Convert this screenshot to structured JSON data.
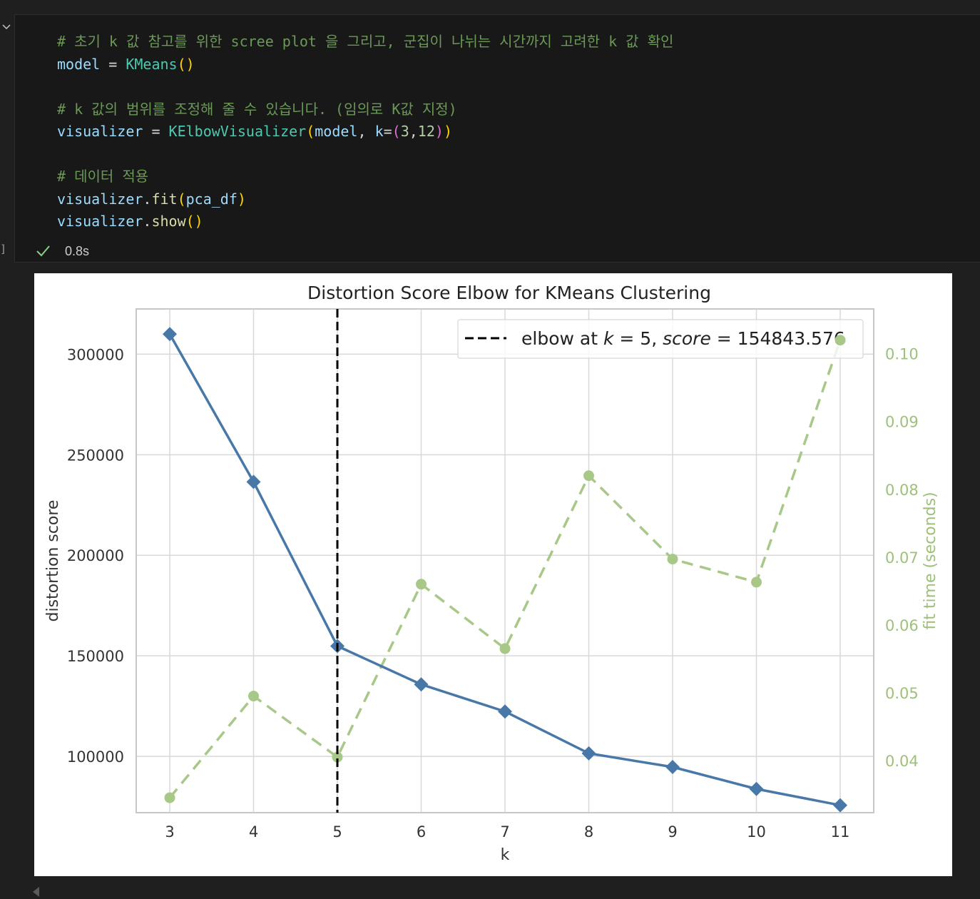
{
  "editor": {
    "gutter_bracket": "]",
    "status_time": "0.8s",
    "code_lines": [
      [
        {
          "t": "# 초기 k 값 참고를 위한 scree plot 을 그리고, 군집이 나뉘는 시간까지 고려한 k 값 확인",
          "c": "cm"
        }
      ],
      [
        {
          "t": "model",
          "c": "var"
        },
        {
          "t": " = ",
          "c": "op"
        },
        {
          "t": "KMeans",
          "c": "cls"
        },
        {
          "t": "()",
          "c": "pa"
        }
      ],
      [],
      [
        {
          "t": "# k 값의 범위를 조정해 줄 수 있습니다. (임의로 K값 지정)",
          "c": "cm"
        }
      ],
      [
        {
          "t": "visualizer",
          "c": "var"
        },
        {
          "t": " = ",
          "c": "op"
        },
        {
          "t": "KElbowVisualizer",
          "c": "cls"
        },
        {
          "t": "(",
          "c": "pa"
        },
        {
          "t": "model",
          "c": "var"
        },
        {
          "t": ", ",
          "c": "op"
        },
        {
          "t": "k",
          "c": "var"
        },
        {
          "t": "=",
          "c": "op"
        },
        {
          "t": "(",
          "c": "pb"
        },
        {
          "t": "3",
          "c": "num"
        },
        {
          "t": ",",
          "c": "op"
        },
        {
          "t": "12",
          "c": "num"
        },
        {
          "t": ")",
          "c": "pb"
        },
        {
          "t": ")",
          "c": "pa"
        }
      ],
      [],
      [
        {
          "t": "# 데이터 적용",
          "c": "cm"
        }
      ],
      [
        {
          "t": "visualizer",
          "c": "var"
        },
        {
          "t": ".",
          "c": "op"
        },
        {
          "t": "fit",
          "c": "fn"
        },
        {
          "t": "(",
          "c": "pa"
        },
        {
          "t": "pca_df",
          "c": "var"
        },
        {
          "t": ")",
          "c": "pa"
        }
      ],
      [
        {
          "t": "visualizer",
          "c": "var"
        },
        {
          "t": ".",
          "c": "op"
        },
        {
          "t": "show",
          "c": "fn"
        },
        {
          "t": "()",
          "c": "pa"
        }
      ]
    ]
  },
  "colors": {
    "distortion": "#4878a8",
    "fit_time": "#a8c888",
    "fit_time_axis": "#9fc07a",
    "elbow": "#000000",
    "grid": "#d8d8d8",
    "axis_text": "#333333"
  },
  "chart_data": {
    "type": "line",
    "title": "Distortion Score Elbow for KMeans Clustering",
    "xlabel": "k",
    "ylabel": "distortion score",
    "y2label": "fit time (seconds)",
    "x": [
      3,
      4,
      5,
      6,
      7,
      8,
      9,
      10,
      11
    ],
    "x_ticks": [
      "3",
      "4",
      "5",
      "6",
      "7",
      "8",
      "9",
      "10",
      "11"
    ],
    "xlim": [
      2.6,
      11.4
    ],
    "ylim": [
      72000,
      322500
    ],
    "y_ticks": [
      100000,
      150000,
      200000,
      250000,
      300000
    ],
    "y_tick_labels": [
      "100000",
      "150000",
      "200000",
      "250000",
      "300000"
    ],
    "y2lim": [
      0.0323,
      0.1066
    ],
    "y2_ticks": [
      0.04,
      0.05,
      0.06,
      0.07,
      0.08,
      0.09,
      0.1
    ],
    "y2_tick_labels": [
      "0.04",
      "0.05",
      "0.06",
      "0.07",
      "0.08",
      "0.09",
      "0.10"
    ],
    "grid": true,
    "legend_position": "top-right",
    "elbow": {
      "k": 5,
      "score": "154843.576",
      "legend_parts": {
        "prefix": "elbow at ",
        "k_var": "k",
        "k_eq": " = 5, ",
        "score_var": "score",
        "score_eq": " = 154843.576"
      }
    },
    "series": [
      {
        "name": "distortion score",
        "axis": "left",
        "style": "solid",
        "marker": "diamond",
        "values": [
          310000,
          236500,
          154843.576,
          135800,
          122300,
          101500,
          94700,
          83800,
          75700
        ]
      },
      {
        "name": "fit time (seconds)",
        "axis": "right",
        "style": "dashed",
        "marker": "circle",
        "values": [
          0.0345,
          0.0495,
          0.0405,
          0.066,
          0.0565,
          0.082,
          0.0697,
          0.0663,
          0.102
        ]
      }
    ]
  }
}
